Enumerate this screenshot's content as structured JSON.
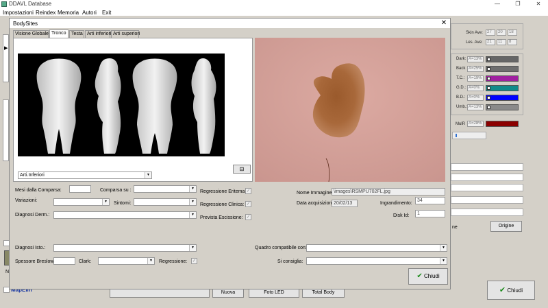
{
  "main_window": {
    "title": "DDAVL Database",
    "menu": [
      "Impostazioni",
      "Reindex",
      "Memoria",
      "Autori",
      "Exit"
    ],
    "controls": {
      "minimize": "—",
      "restore": "❐",
      "close": "✕"
    }
  },
  "right_panel": {
    "skin_ave": {
      "label": "Skin Ave:",
      "values": [
        "27",
        "20",
        "18"
      ]
    },
    "les_ave": {
      "label": "Les. Ave:",
      "values": [
        "21",
        "11",
        "8"
      ]
    },
    "color_rows": [
      {
        "label": "Dark:",
        "value": "A=13%",
        "color": "#666666"
      },
      {
        "label": "Back",
        "value": "A=25%",
        "color": "#6e6e6e"
      },
      {
        "label": "T.C.:",
        "value": "A=19%",
        "color": "#a020a0"
      },
      {
        "label": "G.D.:",
        "value": "A=0%",
        "color": "#108a8a"
      },
      {
        "label": "B.D.:",
        "value": "A=0%",
        "color": "#0000ff"
      },
      {
        "label": "Umb.:",
        "value": "A=13%",
        "color": "#8a8a8a"
      }
    ],
    "mulr": {
      "label": "MulR",
      "value": "A=28%",
      "color": "#8b0000"
    },
    "partial_label": "ne",
    "origine_button": "Origine"
  },
  "bottom_toolbar": {
    "nuova_label": "Nuova",
    "foto_label": "Foto LED",
    "total_body_label": "Total Body",
    "chiudi_label": "Chiudi",
    "mapelm_label": "MapElm",
    "partial_n": "N"
  },
  "dialog": {
    "title": "BodySites",
    "close_glyph": "✕",
    "tabs": [
      "Visione Globale",
      "Tronco",
      "Testa",
      "Arti inferiori",
      "Arti superiori"
    ],
    "active_tab": "Tronco",
    "site_select": "Arti.Inferiori",
    "mini_button_glyph": "⊟",
    "form": {
      "mesi_label": "Mesi dalla Comparsa:",
      "mesi_value": "",
      "comparsa_label": "Comparsa su :",
      "comparsa_value": "",
      "variazioni_label": "Variazioni:",
      "variazioni_value": "",
      "sintomi_label": "Sintomi:",
      "sintomi_value": "",
      "diagnosi_derm_label": "Diagnosi Derm.:",
      "diagnosi_derm_value": "",
      "regressione_eritema_label": "Regressione Eritema:",
      "regressione_clinica_label": "Regressione Clinica:",
      "prevista_escissione_label": "Prevista Escissione:",
      "check_glyph": "✓",
      "nome_immagine_label": "Nome Immagine:",
      "nome_immagine_value": "\\images\\RSMPU702FL.jpg",
      "data_acq_label": "Data acquisizione:",
      "data_acq_value": "20/02/13",
      "ingrandimento_label": "Ingrandimento:",
      "ingrandimento_value": "34",
      "disk_id_label": "Disk Id:",
      "disk_id_value": "1",
      "diagnosi_isto_label": "Diagnosi Isto.:",
      "diagnosi_isto_value": "",
      "spessore_label": "Spessore Breslow:",
      "spessore_value": "",
      "clark_label": "Clark:",
      "clark_value": "",
      "regressione_label": "Regressione:",
      "quadro_label": "Quadro compatibile con:",
      "quadro_value": "",
      "si_consiglia_label": "Si consiglia:",
      "si_consiglia_value": ""
    },
    "chiudi_label": "Chiudi"
  }
}
